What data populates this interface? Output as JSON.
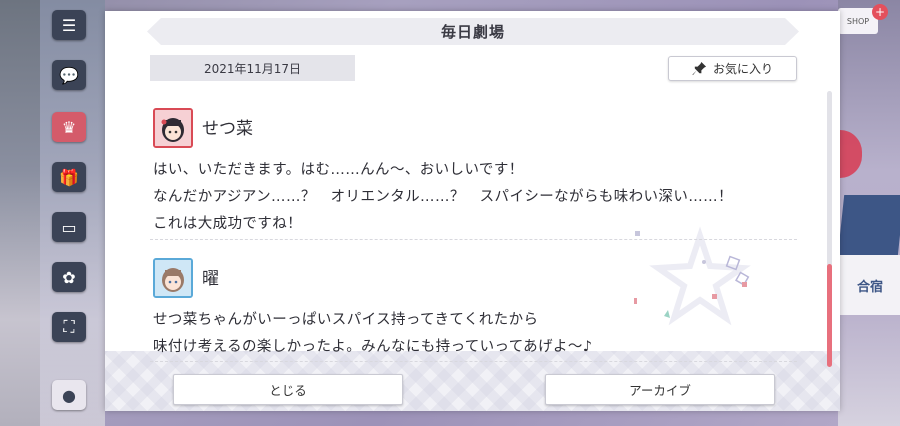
{
  "background": {
    "left_icons": [
      "menu-icon",
      "chat-icon",
      "idol-icon",
      "gift-icon",
      "monitor-icon",
      "event-icon",
      "fullscreen-icon",
      "person-icon"
    ],
    "right_labels": {
      "gift_tag": "SHOP",
      "gift_badge": "+",
      "card_label": "合宿"
    }
  },
  "dialog": {
    "title": "毎日劇場",
    "date": "2021年11月17日",
    "favorite_label": "お気に入り",
    "entries": [
      {
        "speaker": "せつ菜",
        "avatar_color": "#d94a55",
        "lines": [
          "はい、いただきます。はむ……んん～、おいしいです！",
          "なんだかアジアン……？　オリエンタル……？　スパイシーながらも味わい深い……！",
          "これは大成功ですね！"
        ]
      },
      {
        "speaker": "曜",
        "avatar_color": "#5aa9d8",
        "lines": [
          "せつ菜ちゃんがいーっぱいスパイス持ってきてくれたから",
          "味付け考えるの楽しかったよ。みんなにも持っていってあげよ～♪"
        ]
      }
    ],
    "close_label": "とじる",
    "archive_label": "アーカイブ"
  },
  "colors": {
    "accent_scroll": "#e8707d",
    "title_bg": "#ececf1",
    "chip_bg": "#e4e4ea"
  }
}
